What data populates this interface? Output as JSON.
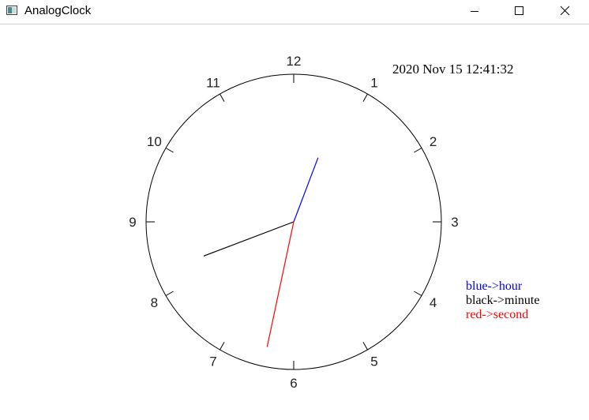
{
  "window": {
    "title": "AnalogClock",
    "icon": "app-window-icon",
    "controls": {
      "minimize_icon": "minimize-icon",
      "maximize_icon": "maximize-icon",
      "close_icon": "close-icon"
    }
  },
  "clock": {
    "numerals": [
      "12",
      "1",
      "2",
      "3",
      "4",
      "5",
      "6",
      "7",
      "8",
      "9",
      "10",
      "11"
    ],
    "datetime": "2020 Nov 15 12:41:32",
    "time": {
      "hours": 12,
      "minutes": 41,
      "seconds": 32
    },
    "colors": {
      "hour_hand": "#0000ff",
      "minute_hand": "#000000",
      "second_hand": "#ff0000",
      "face": "#000000"
    }
  },
  "legend": {
    "hour": {
      "label": "blue->hour",
      "color": "#0000ff"
    },
    "minute": {
      "label": "black->minute",
      "color": "#000000"
    },
    "second": {
      "label": "red->second",
      "color": "#ff0000"
    }
  }
}
